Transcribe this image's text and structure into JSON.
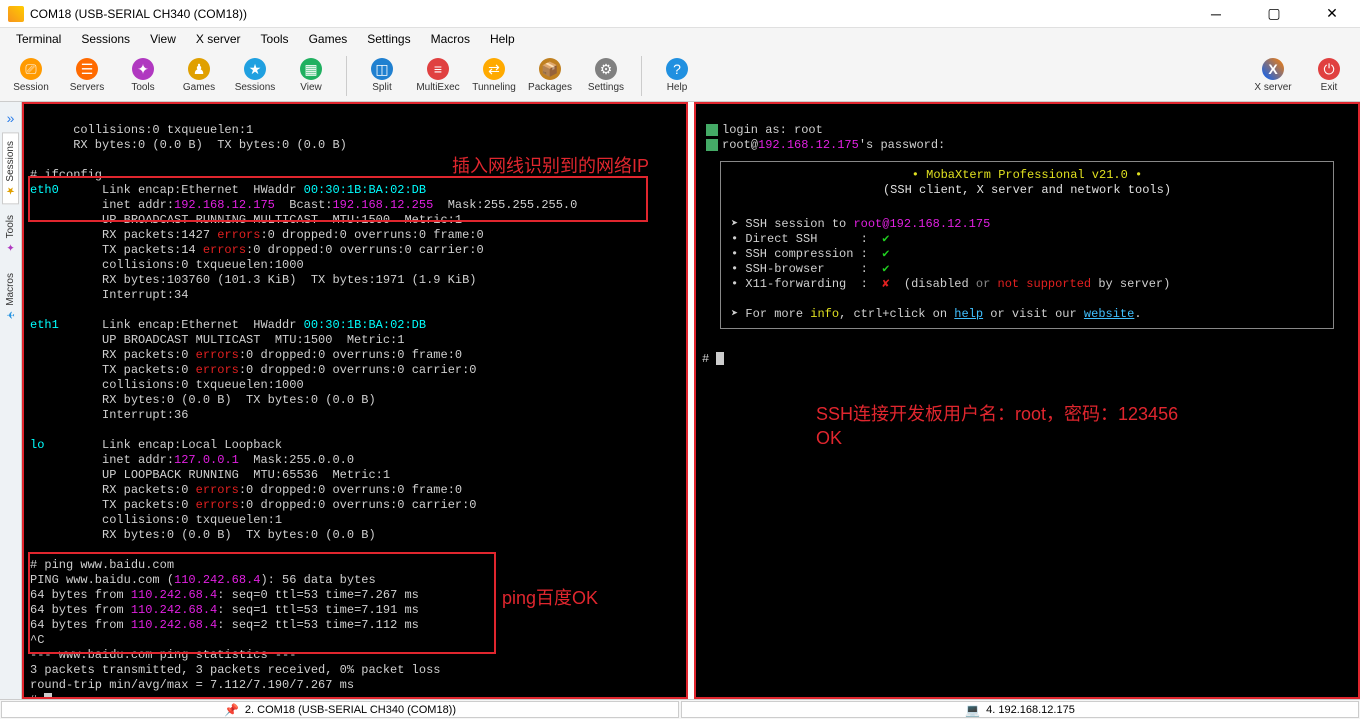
{
  "titlebar": {
    "title": "COM18   (USB-SERIAL CH340 (COM18))"
  },
  "menu": [
    "Terminal",
    "Sessions",
    "View",
    "X server",
    "Tools",
    "Games",
    "Settings",
    "Macros",
    "Help"
  ],
  "toolbar": [
    {
      "label": "Session",
      "color": "#ff9a00",
      "glyph": "⎚"
    },
    {
      "label": "Servers",
      "color": "#ff6a00",
      "glyph": "☰"
    },
    {
      "label": "Tools",
      "color": "#b038c0",
      "glyph": "✦"
    },
    {
      "label": "Games",
      "color": "#e0a000",
      "glyph": "♟"
    },
    {
      "label": "Sessions",
      "color": "#20a0e0",
      "glyph": "★"
    },
    {
      "label": "View",
      "color": "#20b060",
      "glyph": "▦"
    },
    {
      "label": "Split",
      "color": "#2080d0",
      "glyph": "◫"
    },
    {
      "label": "MultiExec",
      "color": "#e04040",
      "glyph": "≡"
    },
    {
      "label": "Tunneling",
      "color": "#ffaa00",
      "glyph": "⇄"
    },
    {
      "label": "Packages",
      "color": "#c08020",
      "glyph": "📦"
    },
    {
      "label": "Settings",
      "color": "#808080",
      "glyph": "⚙"
    },
    {
      "label": "Help",
      "color": "#2090e0",
      "glyph": "?"
    }
  ],
  "toolbar_right": [
    {
      "label": "X server",
      "color": "#20a0e0",
      "glyph": "X"
    },
    {
      "label": "Exit",
      "color": "#e04040",
      "glyph": "⏻"
    }
  ],
  "sidebar_tabs": [
    "Sessions",
    "Tools",
    "Macros"
  ],
  "left_term": {
    "l01": "      collisions:0 txqueuelen:1",
    "l02": "      RX bytes:0 (0.0 B)  TX bytes:0 (0.0 B)",
    "l03": "",
    "l04": "# ifconfig",
    "l05a": "eth0",
    "l05b": "      Link encap:Ethernet  HWaddr ",
    "l05c": "00:30:1B:BA:02:DB",
    "l06a": "          inet addr:",
    "l06b": "192.168.12.175",
    "l06c": "  Bcast:",
    "l06d": "192.168.12.255",
    "l06e": "  Mask:255.255.255.0",
    "l07": "          UP BROADCAST RUNNING MULTICAST  MTU:1500  Metric:1",
    "l08a": "          RX packets:1427 ",
    "l08b": "errors",
    "l08c": ":0 dropped:0 overruns:0 frame:0",
    "l09a": "          TX packets:14 ",
    "l09b": "errors",
    "l09c": ":0 dropped:0 overruns:0 carrier:0",
    "l10": "          collisions:0 txqueuelen:1000",
    "l11": "          RX bytes:103760 (101.3 KiB)  TX bytes:1971 (1.9 KiB)",
    "l12": "          Interrupt:34",
    "l13": "",
    "l14a": "eth1",
    "l14b": "      Link encap:Ethernet  HWaddr ",
    "l14c": "00:30:1B:BA:02:DB",
    "l15": "          UP BROADCAST MULTICAST  MTU:1500  Metric:1",
    "l16a": "          RX packets:0 ",
    "l16b": "errors",
    "l16c": ":0 dropped:0 overruns:0 frame:0",
    "l17a": "          TX packets:0 ",
    "l17b": "errors",
    "l17c": ":0 dropped:0 overruns:0 carrier:0",
    "l18": "          collisions:0 txqueuelen:1000",
    "l19": "          RX bytes:0 (0.0 B)  TX bytes:0 (0.0 B)",
    "l20": "          Interrupt:36",
    "l21": "",
    "l22a": "lo",
    "l22b": "        Link encap:Local Loopback",
    "l23a": "          inet addr:",
    "l23b": "127.0.0.1",
    "l23c": "  Mask:255.0.0.0",
    "l24": "          UP LOOPBACK RUNNING  MTU:65536  Metric:1",
    "l25a": "          RX packets:0 ",
    "l25b": "errors",
    "l25c": ":0 dropped:0 overruns:0 frame:0",
    "l26a": "          TX packets:0 ",
    "l26b": "errors",
    "l26c": ":0 dropped:0 overruns:0 carrier:0",
    "l27": "          collisions:0 txqueuelen:1",
    "l28": "          RX bytes:0 (0.0 B)  TX bytes:0 (0.0 B)",
    "l29": "",
    "l30": "# ping www.baidu.com",
    "l31a": "PING www.baidu.com (",
    "l31b": "110.242.68.4",
    "l31c": "): 56 data bytes",
    "l32a": "64 bytes from ",
    "l32b": "110.242.68.4",
    "l32c": ": seq=0 ttl=53 time=7.267 ms",
    "l33a": "64 bytes from ",
    "l33b": "110.242.68.4",
    "l33c": ": seq=1 ttl=53 time=7.191 ms",
    "l34a": "64 bytes from ",
    "l34b": "110.242.68.4",
    "l34c": ": seq=2 ttl=53 time=7.112 ms",
    "l35": "^C",
    "l36": "--- www.baidu.com ping statistics ---",
    "l37": "3 packets transmitted, 3 packets received, 0% packet loss",
    "l38": "round-trip min/avg/max = 7.112/7.190/7.267 ms",
    "l39": "# "
  },
  "right_term": {
    "r01": "login as: root",
    "r02a": "root@",
    "r02b": "192.168.12.175",
    "r02c": "'s password:",
    "b01": "• MobaXterm Professional v21.0 •",
    "b02": "(SSH client, X server and network tools)",
    "b03a": "➤ SSH session to ",
    "b03b": "root@192.168.12.175",
    "b04a": "• Direct SSH      :  ",
    "b04b": "✔",
    "b05a": "• SSH compression :  ",
    "b05b": "✔",
    "b06a": "• SSH-browser     :  ",
    "b06b": "✔",
    "b07a": "• X11-forwarding  :  ",
    "b07b": "✘",
    "b07c": "  (disabled",
    "b07d": " or ",
    "b07e": "not supported",
    "b07f": " by server)",
    "b08a": "➤ For more ",
    "b08b": "info",
    "b08c": ", ctrl+click on ",
    "b08d": "help",
    "b08e": " or visit our ",
    "b08f": "website",
    "b08g": ".",
    "r09": "# "
  },
  "annotations": {
    "a1": "插入网线识别到的网络IP",
    "a2": "ping百度OK",
    "a3": "SSH连接开发板用户名：root，密码：123456",
    "a4": "OK"
  },
  "status": {
    "left_icon": "📌",
    "left": "2. COM18  (USB-SERIAL CH340 (COM18))",
    "right_icon": "💻",
    "right": "4. 192.168.12.175"
  }
}
